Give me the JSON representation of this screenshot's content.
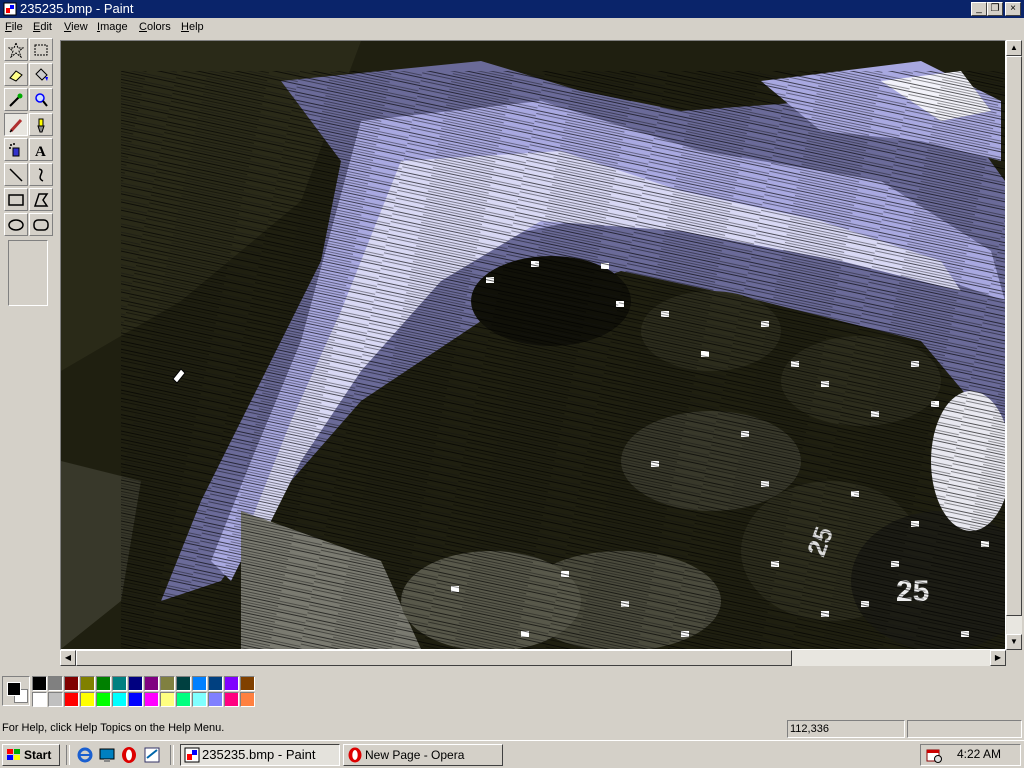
{
  "window": {
    "title": "235235.bmp - Paint",
    "min": "_",
    "restore": "❐",
    "close": "×"
  },
  "menu": [
    {
      "label": "File",
      "key": "F",
      "rest": "ile"
    },
    {
      "label": "Edit",
      "key": "E",
      "rest": "dit"
    },
    {
      "label": "View",
      "key": "V",
      "rest": "iew"
    },
    {
      "label": "Image",
      "key": "I",
      "rest": "mage"
    },
    {
      "label": "Colors",
      "key": "C",
      "rest": "olors"
    },
    {
      "label": "Help",
      "key": "H",
      "rest": "elp"
    }
  ],
  "tools": [
    {
      "name": "free-form-select",
      "icon": "star-select-icon",
      "active": false
    },
    {
      "name": "select",
      "icon": "rect-select-icon",
      "active": false
    },
    {
      "name": "eraser",
      "icon": "eraser-icon",
      "active": false
    },
    {
      "name": "fill-with-color",
      "icon": "paint-bucket-icon",
      "active": false
    },
    {
      "name": "pick-color",
      "icon": "eyedropper-icon",
      "active": false
    },
    {
      "name": "magnifier",
      "icon": "magnifier-icon",
      "active": false
    },
    {
      "name": "pencil",
      "icon": "pencil-icon",
      "active": true
    },
    {
      "name": "brush",
      "icon": "brush-icon",
      "active": false
    },
    {
      "name": "airbrush",
      "icon": "airbrush-icon",
      "active": false
    },
    {
      "name": "text",
      "icon": "text-icon",
      "active": false
    },
    {
      "name": "line",
      "icon": "line-icon",
      "active": false
    },
    {
      "name": "curve",
      "icon": "curve-icon",
      "active": false
    },
    {
      "name": "rectangle",
      "icon": "rectangle-icon",
      "active": false
    },
    {
      "name": "polygon",
      "icon": "polygon-icon",
      "active": false
    },
    {
      "name": "ellipse",
      "icon": "ellipse-icon",
      "active": false
    },
    {
      "name": "rounded-rectangle",
      "icon": "rounded-rect-icon",
      "active": false
    }
  ],
  "palette": {
    "foreground": "#000000",
    "background": "#ffffff",
    "colors_top": [
      "#000000",
      "#808080",
      "#800000",
      "#808000",
      "#008000",
      "#008080",
      "#000080",
      "#800080",
      "#808040",
      "#004040",
      "#0080ff",
      "#004080",
      "#8000ff",
      "#804000"
    ],
    "colors_bottom": [
      "#ffffff",
      "#c0c0c0",
      "#ff0000",
      "#ffff00",
      "#00ff00",
      "#00ffff",
      "#0000ff",
      "#ff00ff",
      "#ffff80",
      "#00ff80",
      "#80ffff",
      "#8080ff",
      "#ff0080",
      "#ff8040"
    ]
  },
  "status": {
    "help": "For Help, click Help Topics on the Help Menu.",
    "coords": "112,336",
    "size": ""
  },
  "taskbar": {
    "start": "Start",
    "quicklaunch": [
      "internet-explorer-icon",
      "desktop-icon",
      "opera-icon",
      "outlook-icon"
    ],
    "tasks": [
      {
        "label": "235235.bmp - Paint",
        "icon": "paint-icon",
        "active": true
      },
      {
        "label": "New Page - Opera",
        "icon": "opera-icon",
        "active": false
      }
    ],
    "time": "4:22 AM"
  },
  "image_description_colors": {
    "dark": "#2a2a18",
    "lavender": "#a8a8e0",
    "white": "#f4f4f4",
    "chip": "#1c1c14"
  }
}
